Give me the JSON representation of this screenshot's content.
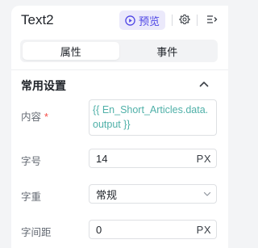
{
  "header": {
    "title": "Text2",
    "preview_label": "预览",
    "icons": [
      "play-circle-icon",
      "gear-icon",
      "outline-menu-icon"
    ]
  },
  "tabs": [
    {
      "label": "属性",
      "active": true
    },
    {
      "label": "事件",
      "active": false
    }
  ],
  "section": {
    "title": "常用设置"
  },
  "fields": {
    "content": {
      "label": "内容",
      "required_mark": "*",
      "value": "{{ En_Short_Articles.data.output }}"
    },
    "font_size": {
      "label": "字号",
      "value": "14",
      "unit": "PX"
    },
    "font_weight": {
      "label": "字重",
      "value": "常规"
    },
    "letter_spacing": {
      "label": "字间距",
      "value": "0",
      "unit": "PX"
    }
  },
  "colors": {
    "accent": "#4f46e5",
    "accent_bg": "#ebe9fb",
    "binding_text": "#4fb0a8",
    "required": "#f54a45",
    "page_bg": "#f3f4f6"
  }
}
